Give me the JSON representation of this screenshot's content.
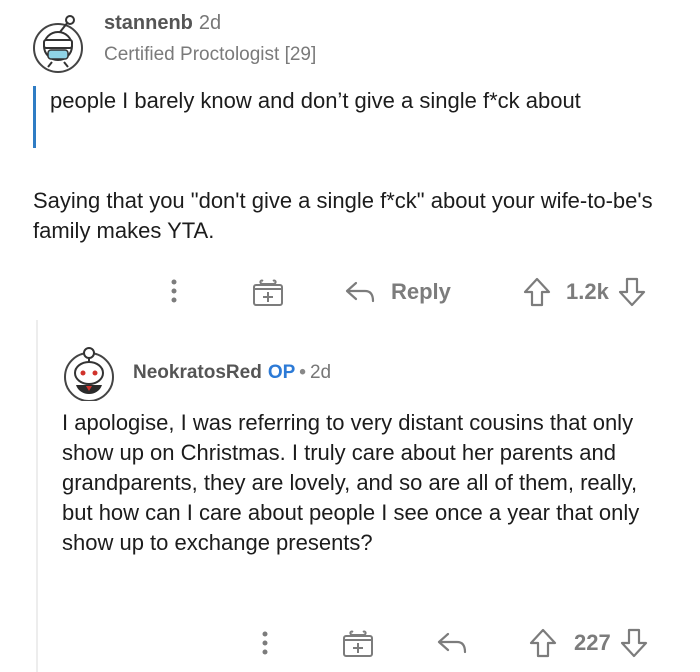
{
  "comment": {
    "username": "stannenb",
    "age": "2d",
    "flair": "Certified Proctologist [29]",
    "quote": "people I barely know and don’t give a single f*ck about",
    "body": "Saying that you \"don't give a single f*ck\" about your wife-to-be's family makes YTA.",
    "actions": {
      "reply_label": "Reply",
      "score": "1.2k"
    }
  },
  "reply": {
    "username": "NeokratosRed",
    "op_badge": "OP",
    "separator": "•",
    "age": "2d",
    "body": "I apologise, I was referring to very distant cousins that only show up on Christmas. I truly care about her parents and grandparents, they are lovely, and so are all of them, really, but how can I care about people I see once a year that only show up to exchange presents?",
    "actions": {
      "score": "227"
    }
  },
  "colors": {
    "quote_bar": "#2f7cc4",
    "op": "#2c7ad6",
    "action_gray": "#7c7c7c"
  },
  "icons": [
    "more-icon",
    "gift-icon",
    "reply-icon",
    "upvote-icon",
    "downvote-icon",
    "snoo-avatar-icon"
  ]
}
